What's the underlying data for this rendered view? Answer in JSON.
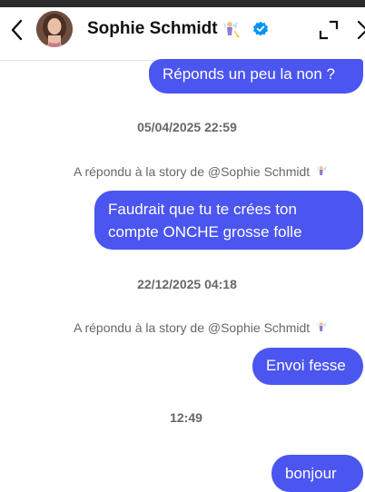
{
  "header": {
    "contact_name": "Sophie Schmidt",
    "verified": true,
    "accent_color": "#4b55f0"
  },
  "messages": {
    "m1": "Réponds un peu la non ?",
    "ts1": "05/04/2025 22:59",
    "note1": "A répondu à la story de @Sophie Schmidt",
    "m2": "Faudrait que tu te crées ton compte ONCHE grosse folle",
    "ts2": "22/12/2025 04:18",
    "note2": "A répondu à la story de @Sophie Schmidt",
    "m3": "Envoi fesse",
    "ts3": "12:49",
    "m4": "bonjour"
  },
  "icons": {
    "back": "chevron-left-icon",
    "expand": "expand-icon",
    "close": "close-icon",
    "verified": "verified-badge-icon",
    "emoji": "fairy-emoji-icon"
  }
}
